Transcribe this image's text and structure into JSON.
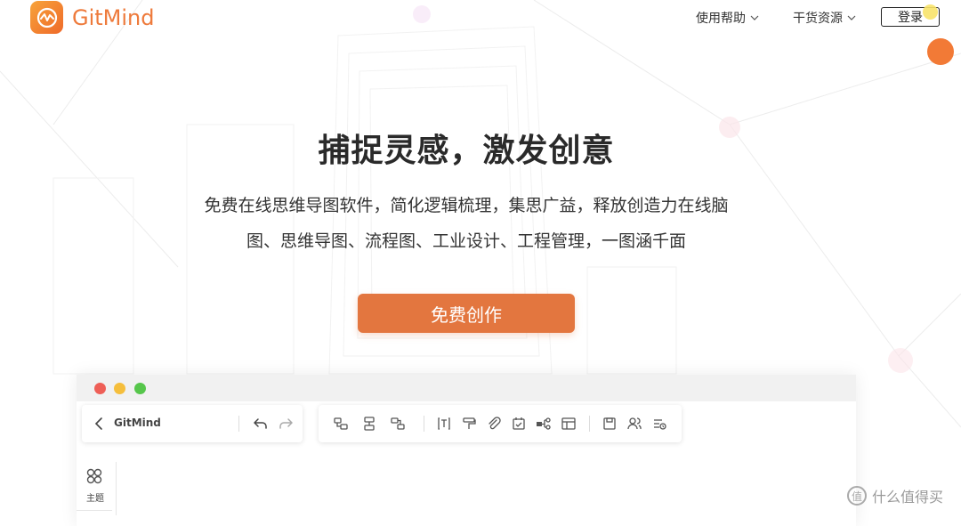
{
  "brand": {
    "name": "GitMind"
  },
  "nav": {
    "help_label": "使用帮助",
    "resources_label": "干货资源",
    "login_label": "登录"
  },
  "hero": {
    "title": "捕捉灵感，激发创意",
    "subtitle_line1": "免费在线思维导图软件，简化逻辑梳理，集思广益，释放创造力在线脑",
    "subtitle_line2": "图、思维导图、流程图、工业设计、工程管理，一图涵千面",
    "cta_label": "免费创作"
  },
  "app_preview": {
    "app_name": "GitMind",
    "toolbar_left_icons": [
      "back-chevron-icon",
      "undo-icon",
      "redo-icon"
    ],
    "toolbar_right_icons": [
      "sibling-node-icon",
      "child-node-icon",
      "parent-node-icon",
      "text-format-icon",
      "format-painter-icon",
      "attachment-icon",
      "task-icon",
      "relation-icon",
      "layout-icon",
      "save-icon",
      "collaborate-icon",
      "outline-icon"
    ],
    "sidebar_tab_label": "主题"
  },
  "watermark": {
    "text": "什么值得买"
  },
  "colors": {
    "brand_orange": "#ee7a3b",
    "cta_orange": "#e3763f",
    "traffic_red": "#ee5f57",
    "traffic_yellow": "#f5be3c",
    "traffic_green": "#56c64b"
  }
}
